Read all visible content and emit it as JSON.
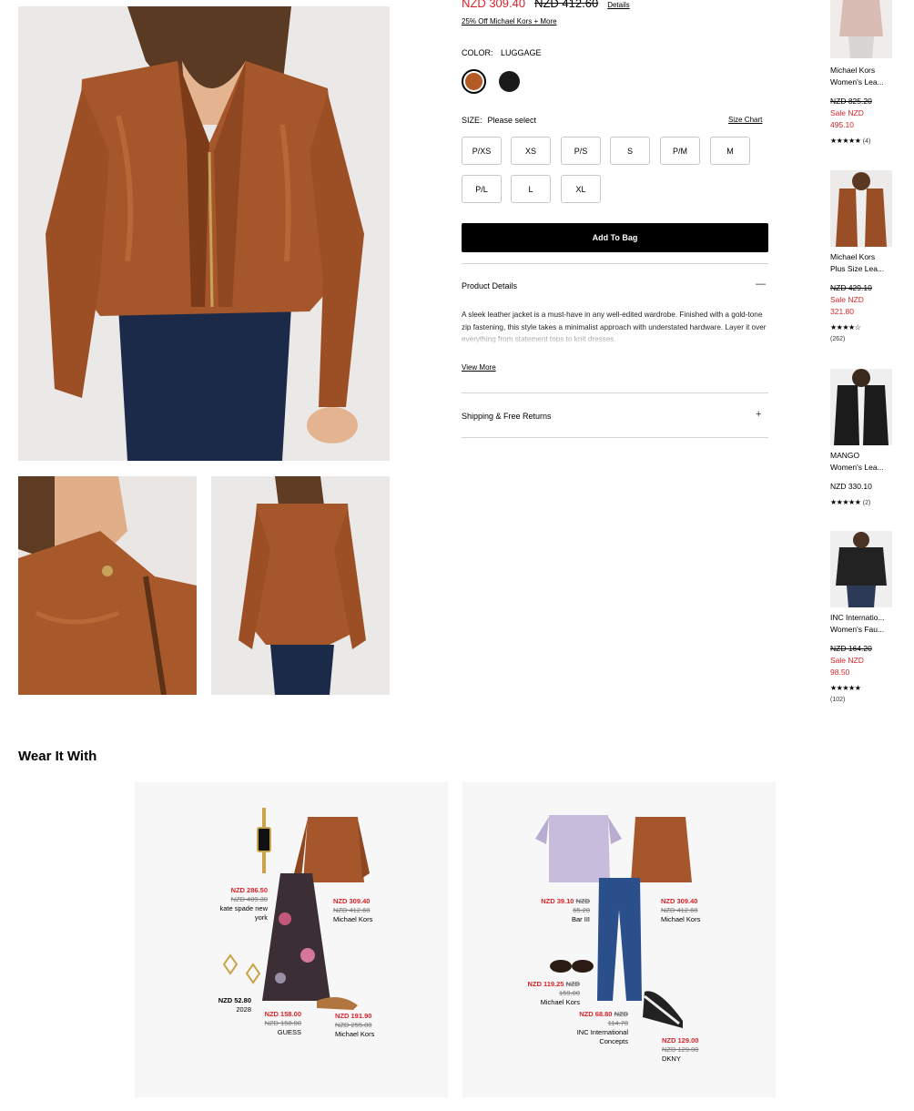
{
  "product": {
    "price_sale": "NZD 309.40",
    "price_original": "NZD 412.60",
    "details_link": "Details",
    "promo": "25% Off Michael Kors + More",
    "color_label": "COLOR:",
    "color_value": "LUGGAGE",
    "swatches": [
      "luggage",
      "black"
    ],
    "size_label": "SIZE:",
    "size_prompt": "Please select",
    "size_chart": "Size Chart",
    "sizes": [
      "P/XS",
      "XS",
      "P/S",
      "S",
      "P/M",
      "M",
      "P/L",
      "L",
      "XL"
    ],
    "add_to_bag": "Add To Bag",
    "product_details_title": "Product Details",
    "product_details_sign": "—",
    "description": "A sleek leather jacket is a must-have in any well-edited wardrobe. Finished with a gold-tone zip fastening, this style takes a minimalist approach with understated hardware. Layer it over everything from statement tops to knit dresses.",
    "view_more": "View More",
    "shipping_title": "Shipping & Free Returns",
    "shipping_sign": "+"
  },
  "recommendations": [
    {
      "name1": "Michael Kors",
      "name2": "Women's Lea...",
      "orig": "NZD 825.20",
      "sale1": "Sale NZD",
      "sale2": "495.10",
      "stars": "★★★★★",
      "count": "(4)"
    },
    {
      "name1": "Michael Kors",
      "name2": "Plus Size Lea...",
      "orig": "NZD 429.10",
      "sale1": "Sale NZD",
      "sale2": "321.80",
      "stars": "★★★★☆",
      "count": "(262)"
    },
    {
      "name1": "MANGO",
      "name2": "Women's Lea...",
      "price": "NZD 330.10",
      "stars": "★★★★★",
      "count": "(2)"
    },
    {
      "name1": "INC Internatio...",
      "name2": "Women's Fau...",
      "orig": "NZD 164.20",
      "sale1": "Sale NZD",
      "sale2": "98.50",
      "stars": "★★★★★",
      "count": "(102)"
    }
  ],
  "wear_it_with": {
    "title": "Wear It With",
    "outfit1": [
      {
        "price": "NZD 286.50",
        "orig": "NZD 409.30",
        "brand1": "kate spade new",
        "brand2": "york"
      },
      {
        "price": "NZD 309.40",
        "orig": "NZD 412.60",
        "brand1": "Michael Kors"
      },
      {
        "price": "NZD 52.80",
        "brand1": "2028"
      },
      {
        "price": "NZD 158.00",
        "orig": "NZD 158.00",
        "brand1": "GUESS"
      },
      {
        "price": "NZD 191.90",
        "orig": "NZD 255.80",
        "brand1": "Michael Kors"
      }
    ],
    "outfit2": [
      {
        "price": "NZD 39.10",
        "price_suffix": "NZD",
        "orig": "65.20",
        "brand1": "Bar III"
      },
      {
        "price": "NZD 309.40",
        "orig": "NZD 412.60",
        "brand1": "Michael Kors"
      },
      {
        "price": "NZD 119.25",
        "price_suffix": "NZD",
        "orig": "159.00",
        "brand1": "Michael Kors"
      },
      {
        "price": "NZD 68.80",
        "price_suffix": "NZD",
        "orig": "114.70",
        "brand1": "INC International",
        "brand2": "Concepts"
      },
      {
        "price": "NZD 129.00",
        "orig": "NZD 129.00",
        "brand1": "DKNY"
      }
    ]
  }
}
